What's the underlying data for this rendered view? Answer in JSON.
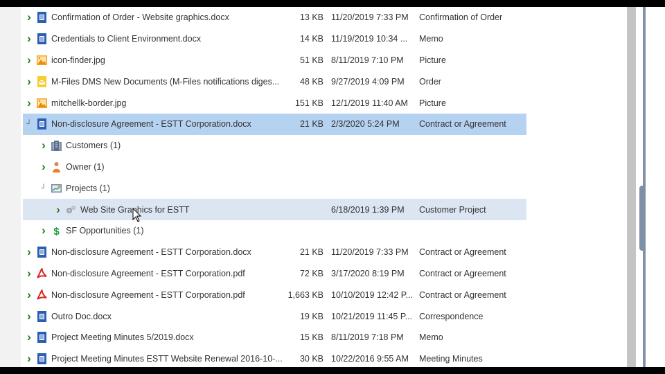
{
  "rows": [
    {
      "level": 0,
      "state": "collapsed",
      "icon": "word-doc-icon",
      "name": "Confirmation of Order - Website graphics.docx",
      "size": "13 KB",
      "date": "11/20/2019 7:33 PM",
      "type": "Confirmation of Order"
    },
    {
      "level": 0,
      "state": "collapsed",
      "icon": "word-doc-icon",
      "name": "Credentials to Client Environment.docx",
      "size": "14 KB",
      "date": "11/19/2019 10:34 ...",
      "type": "Memo"
    },
    {
      "level": 0,
      "state": "collapsed",
      "icon": "image-icon",
      "name": "icon-finder.jpg",
      "size": "51 KB",
      "date": "8/11/2019 7:10 PM",
      "type": "Picture"
    },
    {
      "level": 0,
      "state": "collapsed",
      "icon": "email-icon",
      "name": "M-Files DMS New Documents (M-Files notifications diges...",
      "size": "48 KB",
      "date": "9/27/2019 4:09 PM",
      "type": "Order"
    },
    {
      "level": 0,
      "state": "collapsed",
      "icon": "image-icon",
      "name": "mitchellk-border.jpg",
      "size": "151 KB",
      "date": "12/1/2019 11:40 AM",
      "type": "Picture"
    },
    {
      "level": 0,
      "state": "expanded",
      "selected": true,
      "icon": "word-doc-icon",
      "name": "Non-disclosure Agreement - ESTT Corporation.docx",
      "size": "21 KB",
      "date": "2/3/2020 5:24 PM",
      "type": "Contract or Agreement"
    },
    {
      "level": 1,
      "state": "collapsed",
      "icon": "building-icon",
      "name": "Customers (1)",
      "size": "",
      "date": "",
      "type": ""
    },
    {
      "level": 1,
      "state": "collapsed",
      "icon": "person-icon",
      "name": "Owner (1)",
      "size": "",
      "date": "",
      "type": ""
    },
    {
      "level": 1,
      "state": "expanded",
      "icon": "project-icon",
      "name": "Projects (1)",
      "size": "",
      "date": "",
      "type": ""
    },
    {
      "level": 2,
      "state": "collapsed",
      "hover": true,
      "icon": "gears-icon",
      "name": "Web Site Graphics for ESTT",
      "size": "",
      "date": "6/18/2019 1:39 PM",
      "type": "Customer Project"
    },
    {
      "level": 1,
      "state": "collapsed",
      "icon": "dollar-icon",
      "name": "SF Opportunities (1)",
      "size": "",
      "date": "",
      "type": ""
    },
    {
      "level": 0,
      "state": "collapsed",
      "icon": "word-doc-icon",
      "name": "Non-disclosure Agreement - ESTT Corporation.docx",
      "size": "21 KB",
      "date": "11/20/2019 7:33 PM",
      "type": "Contract or Agreement"
    },
    {
      "level": 0,
      "state": "collapsed",
      "icon": "pdf-icon",
      "name": "Non-disclosure Agreement - ESTT Corporation.pdf",
      "size": "72 KB",
      "date": "3/17/2020 8:19 PM",
      "type": "Contract or Agreement"
    },
    {
      "level": 0,
      "state": "collapsed",
      "icon": "pdf-icon",
      "name": "Non-disclosure Agreement - ESTT Corporation.pdf",
      "size": "1,663 KB",
      "date": "10/10/2019 12:42 P...",
      "type": "Contract or Agreement"
    },
    {
      "level": 0,
      "state": "collapsed",
      "icon": "word-doc-icon",
      "name": "Outro Doc.docx",
      "size": "19 KB",
      "date": "10/21/2019 11:45 P...",
      "type": "Correspondence"
    },
    {
      "level": 0,
      "state": "collapsed",
      "icon": "word-doc-icon",
      "name": "Project Meeting Minutes 5/2019.docx",
      "size": "15 KB",
      "date": "8/11/2019 7:18 PM",
      "type": "Memo"
    },
    {
      "level": 0,
      "state": "collapsed",
      "icon": "word-doc-icon",
      "name": "Project Meeting Minutes ESTT Website Renewal 2016-10-...",
      "size": "30 KB",
      "date": "10/22/2016 9:55 AM",
      "type": "Meeting Minutes"
    }
  ],
  "colors": {
    "selected": "#b5d2f1",
    "hover": "#dce6f3",
    "scrollbar": "#c4c4c4"
  }
}
